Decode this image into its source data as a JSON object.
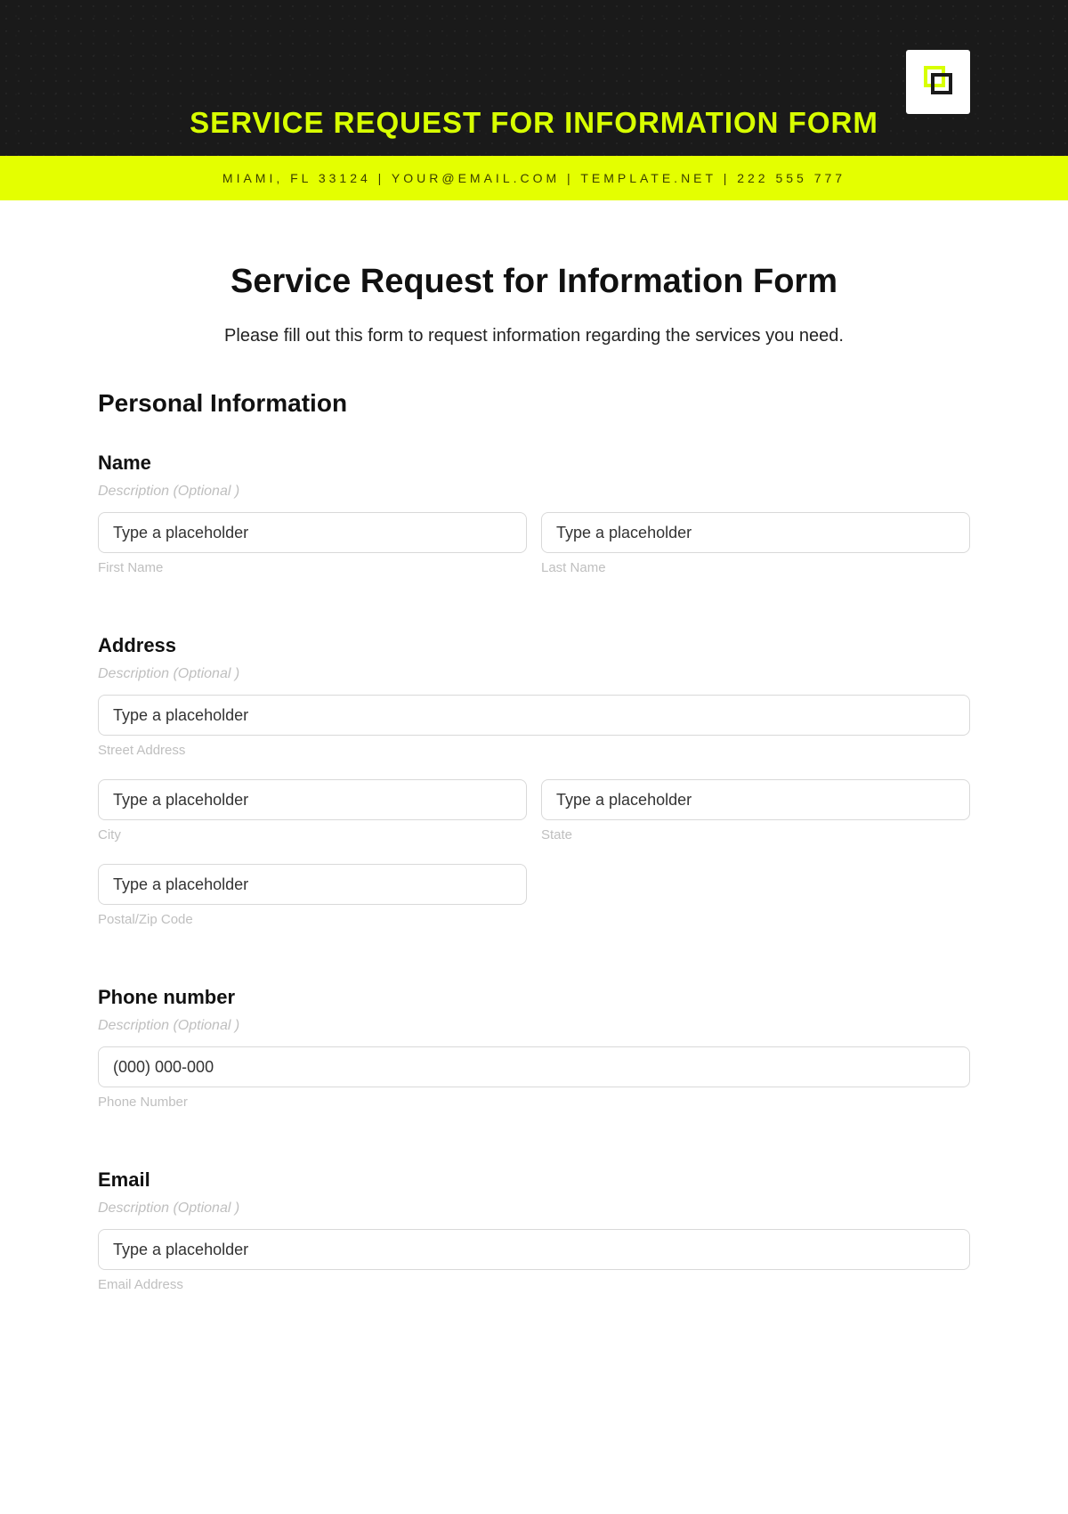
{
  "hero": {
    "title": "SERVICE REQUEST FOR INFORMATION FORM",
    "contact_line": "MIAMI, FL 33124 | YOUR@EMAIL.COM | TEMPLATE.NET | 222 555 777"
  },
  "page": {
    "title": "Service Request for Information Form",
    "description": "Please fill out this form to request information regarding the services you need."
  },
  "section_personal": {
    "title": "Personal Information"
  },
  "fields": {
    "name": {
      "label": "Name",
      "hint": "Description  (Optional )",
      "first": {
        "placeholder": "Type a placeholder",
        "sublabel": "First Name"
      },
      "last": {
        "placeholder": "Type a placeholder",
        "sublabel": "Last Name"
      }
    },
    "address": {
      "label": "Address",
      "hint": "Description  (Optional )",
      "street": {
        "placeholder": "Type a placeholder",
        "sublabel": "Street Address"
      },
      "city": {
        "placeholder": "Type a placeholder",
        "sublabel": "City"
      },
      "state": {
        "placeholder": "Type a placeholder",
        "sublabel": "State"
      },
      "postal": {
        "placeholder": "Type a placeholder",
        "sublabel": "Postal/Zip Code"
      }
    },
    "phone": {
      "label": "Phone number",
      "hint": "Description  (Optional )",
      "number": {
        "placeholder": "(000) 000-000",
        "sublabel": "Phone Number"
      }
    },
    "email": {
      "label": "Email",
      "hint": "Description  (Optional )",
      "address": {
        "placeholder": "Type a placeholder",
        "sublabel": "Email Address"
      }
    }
  }
}
